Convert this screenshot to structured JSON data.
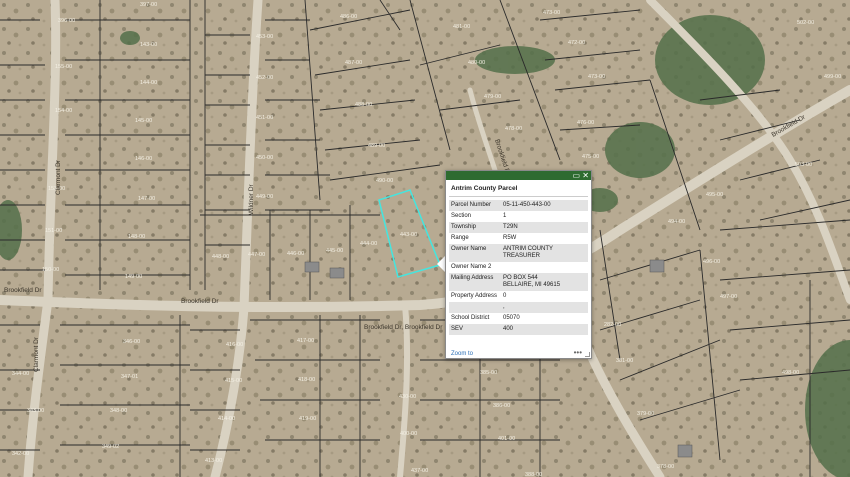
{
  "map": {
    "parcels": [
      {
        "label": "396-00"
      },
      {
        "label": "397-00"
      },
      {
        "label": "143-00"
      },
      {
        "label": "144-00"
      },
      {
        "label": "155-00"
      },
      {
        "label": "154-00"
      },
      {
        "label": "145-00"
      },
      {
        "label": "153-00"
      },
      {
        "label": "146-00"
      },
      {
        "label": "152-00"
      },
      {
        "label": "147-00"
      },
      {
        "label": "151-00"
      },
      {
        "label": "148-00"
      },
      {
        "label": "150-00"
      },
      {
        "label": "149-00"
      },
      {
        "label": "453-00"
      },
      {
        "label": "452-00"
      },
      {
        "label": "451-00"
      },
      {
        "label": "450-00"
      },
      {
        "label": "449-00"
      },
      {
        "label": "448-00"
      },
      {
        "label": "447-00"
      },
      {
        "label": "446-00"
      },
      {
        "label": "445-00"
      },
      {
        "label": "444-00"
      },
      {
        "label": "443-00"
      },
      {
        "label": "486-00"
      },
      {
        "label": "487-00"
      },
      {
        "label": "488-00"
      },
      {
        "label": "489-00"
      },
      {
        "label": "490-00"
      },
      {
        "label": "481-00"
      },
      {
        "label": "473-00"
      },
      {
        "label": "472-00"
      },
      {
        "label": "480-00"
      },
      {
        "label": "479-00"
      },
      {
        "label": "478-00"
      },
      {
        "label": "476-00"
      },
      {
        "label": "475-00"
      },
      {
        "label": "473-00"
      },
      {
        "label": "502-00"
      },
      {
        "label": "503-00"
      },
      {
        "label": "495-00"
      },
      {
        "label": "494-00"
      },
      {
        "label": "499-00"
      },
      {
        "label": "496-00"
      },
      {
        "label": "497-00"
      },
      {
        "label": "498-00"
      },
      {
        "label": "282-00"
      },
      {
        "label": "381-00"
      },
      {
        "label": "379-00"
      },
      {
        "label": "378-00"
      },
      {
        "label": "346-00"
      },
      {
        "label": "347-01"
      },
      {
        "label": "348-00"
      },
      {
        "label": "349-02"
      },
      {
        "label": "344-00"
      },
      {
        "label": "343-00"
      },
      {
        "label": "342-00"
      },
      {
        "label": "416-00"
      },
      {
        "label": "417-00"
      },
      {
        "label": "415-00"
      },
      {
        "label": "418-00"
      },
      {
        "label": "414-00"
      },
      {
        "label": "419-00"
      },
      {
        "label": "413-00"
      },
      {
        "label": "420-00"
      },
      {
        "label": "430-00"
      },
      {
        "label": "385-00"
      },
      {
        "label": "386-00"
      },
      {
        "label": "437-00"
      },
      {
        "label": "388-00"
      },
      {
        "label": "400-00"
      },
      {
        "label": "401-00"
      }
    ],
    "roads": [
      {
        "name": "Clarmont Dr"
      },
      {
        "name": "Wildner Dr"
      },
      {
        "name": "Brookfield Dr"
      },
      {
        "name": "Brookfield Dr"
      },
      {
        "name": "Brookfield Dr"
      },
      {
        "name": "Brookfield Dr, Brookfield Dr"
      },
      {
        "name": "Brookfield Dr"
      },
      {
        "name": "Clarmont Dr"
      }
    ]
  },
  "popup": {
    "title": "Antrim County Parcel",
    "controls": {
      "restore": "▭",
      "close": "✕"
    },
    "fields": [
      {
        "key": "Parcel Number",
        "value": "05-11-450-443-00"
      },
      {
        "key": "Section",
        "value": "1"
      },
      {
        "key": "Township",
        "value": "T29N"
      },
      {
        "key": "Range",
        "value": "R5W"
      },
      {
        "key": "Owner Name",
        "value": "ANTRIM COUNTY TREASURER"
      },
      {
        "key": "Owner Name 2",
        "value": ""
      },
      {
        "key": "Mailing Address",
        "value": "PO BOX 544\nBELLAIRE, MI 49615"
      },
      {
        "key": "Property Address",
        "value": "0"
      },
      {
        "key": "",
        "value": ","
      },
      {
        "key": "School District",
        "value": "05070"
      },
      {
        "key": "SEV",
        "value": "400"
      }
    ],
    "zoom_link": "Zoom to",
    "more_label": "•••"
  }
}
